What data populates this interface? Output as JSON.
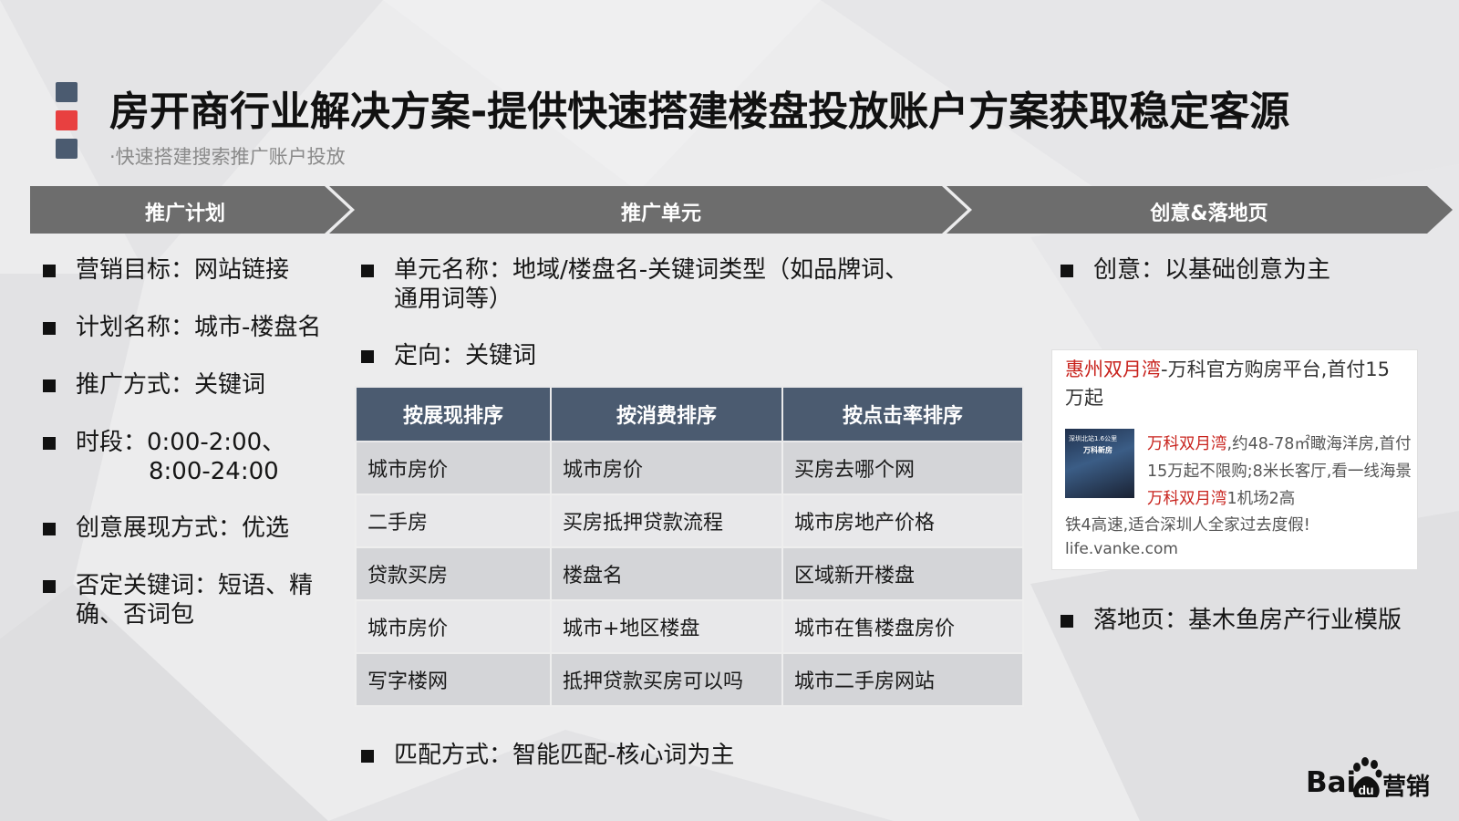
{
  "colors": {
    "red_accent": "#e84040",
    "slate": "#4b5b70",
    "chevron": "#6d6d6d",
    "link_red": "#c8231d"
  },
  "header": {
    "title": "房开商行业解决方案-提供快速搭建楼盘投放账户方案获取稳定客源",
    "subtitle": "·快速搭建搜索推广账户投放"
  },
  "stages": [
    "推广计划",
    "推广单元",
    "创意&落地页"
  ],
  "plan": {
    "items": [
      {
        "text": "营销目标：网站链接"
      },
      {
        "text": "计划名称：城市-楼盘名"
      },
      {
        "text": "推广方式：关键词"
      },
      {
        "text": "时段：0:00-2:00、",
        "cont": "8:00-24:00"
      },
      {
        "text": "创意展现方式：优选"
      },
      {
        "text": "否定关键词：短语、精",
        "cont2": "确、否词包"
      }
    ]
  },
  "unit": {
    "name_label": "单元名称：地域/楼盘名-关键词类型（如品牌词、",
    "name_label_2": "通用词等）",
    "targeting": "定向：关键词",
    "match": "匹配方式：智能匹配-核心词为主",
    "table": {
      "headers": [
        "按展现排序",
        "按消费排序",
        "按点击率排序"
      ],
      "rows": [
        [
          "城市房价",
          "城市房价",
          "买房去哪个网"
        ],
        [
          "二手房",
          "买房抵押贷款流程",
          "城市房地产价格"
        ],
        [
          "贷款买房",
          "楼盘名",
          "区域新开楼盘"
        ],
        [
          "城市房价",
          "城市+地区楼盘",
          "城市在售楼盘房价"
        ],
        [
          "写字楼网",
          "抵押贷款买房可以吗",
          "城市二手房网站"
        ]
      ]
    }
  },
  "creative": {
    "label": "创意：以基础创意为主",
    "landing": "落地页：基木鱼房产行业模版",
    "ad": {
      "title_red": "惠州双月湾",
      "title_rest": "-万科官方购房平台,首付15万起",
      "thumb_line1": "深圳北站1.6公里",
      "thumb_line2": "万科新房",
      "desc_red1": "万科双月湾",
      "desc_1": ",约48-78㎡瞰海洋房,首付15万起不限购;8米长客厅,看一线海景",
      "desc_red2": "万科双月湾",
      "desc_2": "1机场2高",
      "desc_tail": "铁4高速,适合深圳人全家过去度假!",
      "url": "life.vanke.com"
    }
  },
  "logo": {
    "bai": "Bai",
    "ying": "营销"
  }
}
